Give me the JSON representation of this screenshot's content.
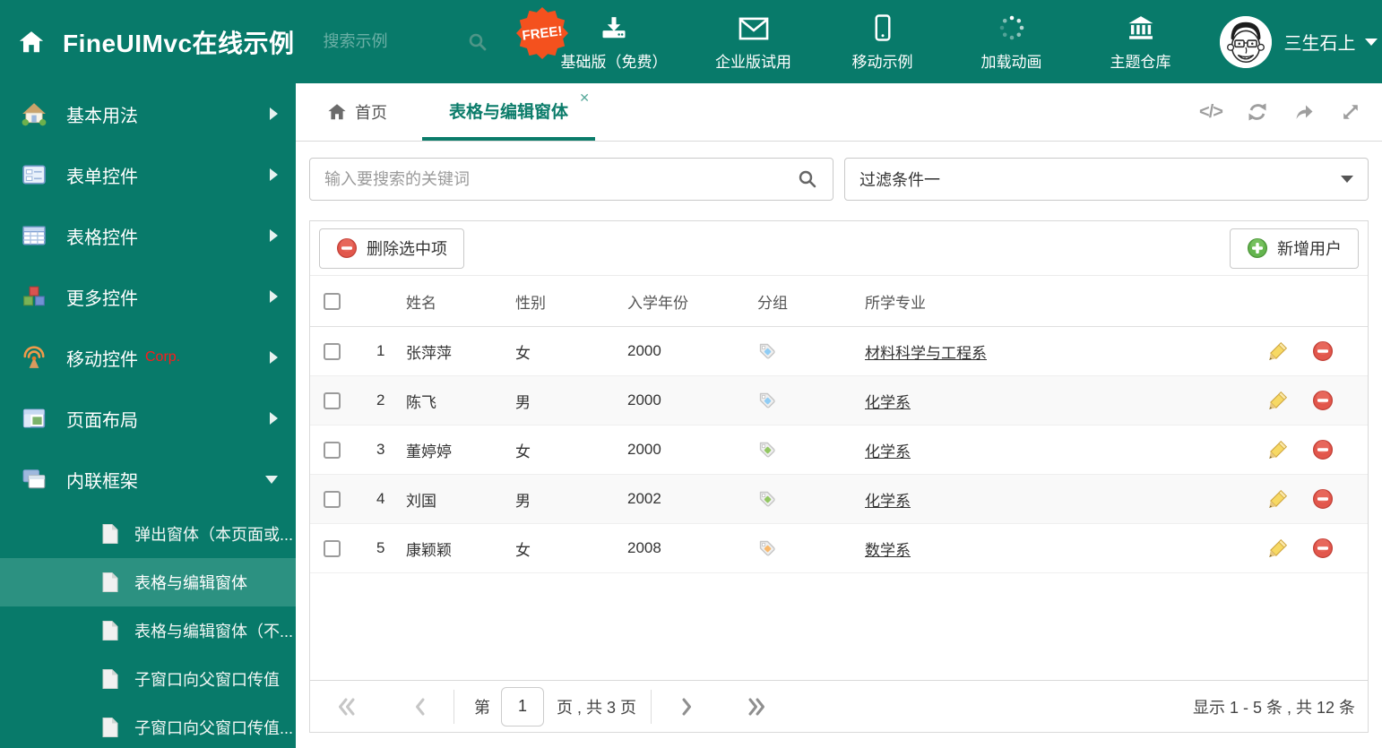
{
  "colors": {
    "teal": "#087a6a",
    "teal_active": "#2c9181",
    "accent": "#0b7c6a",
    "free_badge": "#f4511e"
  },
  "header": {
    "title": "FineUIMvc在线示例",
    "search_placeholder": "搜索示例",
    "free_badge": "FREE!",
    "nav": [
      {
        "label": "基础版（免费）"
      },
      {
        "label": "企业版试用"
      },
      {
        "label": "移动示例"
      },
      {
        "label": "加载动画"
      },
      {
        "label": "主题仓库"
      }
    ],
    "user_name": "三生石上"
  },
  "sidebar": {
    "items": [
      {
        "label": "基本用法"
      },
      {
        "label": "表单控件"
      },
      {
        "label": "表格控件"
      },
      {
        "label": "更多控件"
      },
      {
        "label": "移动控件",
        "suffix": "Corp."
      },
      {
        "label": "页面布局"
      },
      {
        "label": "内联框架"
      }
    ],
    "subitems": [
      {
        "label": "弹出窗体（本页面或..."
      },
      {
        "label": "表格与编辑窗体"
      },
      {
        "label": "表格与编辑窗体（不..."
      },
      {
        "label": "子窗口向父窗口传值"
      },
      {
        "label": "子窗口向父窗口传值..."
      }
    ]
  },
  "tabs": {
    "home": "首页",
    "active": "表格与编辑窗体"
  },
  "filters": {
    "search_placeholder": "输入要搜索的关键词",
    "filter_value": "过滤条件一"
  },
  "toolbar": {
    "delete_label": "删除选中项",
    "add_label": "新增用户"
  },
  "table": {
    "columns": {
      "name": "姓名",
      "gender": "性别",
      "year": "入学年份",
      "group": "分组",
      "major": "所学专业"
    },
    "rows": [
      {
        "num": "1",
        "name": "张萍萍",
        "gender": "女",
        "year": "2000",
        "tag_color": "#90cdf5",
        "major": "材料科学与工程系"
      },
      {
        "num": "2",
        "name": "陈飞",
        "gender": "男",
        "year": "2000",
        "tag_color": "#90cdf5",
        "major": "化学系"
      },
      {
        "num": "3",
        "name": "董婷婷",
        "gender": "女",
        "year": "2000",
        "tag_color": "#93c763",
        "major": "化学系"
      },
      {
        "num": "4",
        "name": "刘国",
        "gender": "男",
        "year": "2002",
        "tag_color": "#93c763",
        "major": "化学系"
      },
      {
        "num": "5",
        "name": "康颖颖",
        "gender": "女",
        "year": "2008",
        "tag_color": "#f8b86b",
        "major": "数学系"
      }
    ]
  },
  "pagination": {
    "page_prefix": "第",
    "page_value": "1",
    "page_suffix": "页 , 共 3 页",
    "summary": "显示 1 - 5 条 , 共 12 条"
  }
}
